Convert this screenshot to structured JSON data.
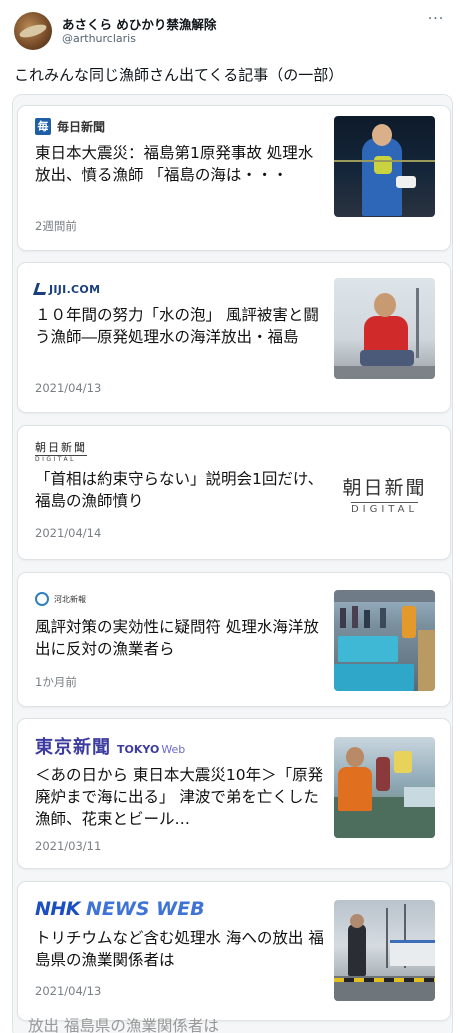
{
  "tweet": {
    "display_name": "あさくら めひかり禁漁解除",
    "handle": "@arthurclaris",
    "text": "これみんな同じ漁師さん出てくる記事（の一部）"
  },
  "cards": [
    {
      "source_name": "毎日新聞",
      "logo_mark": "毎",
      "headline": "東日本大震災：福島第1原発事故 処理水放出、憤る漁師 「福島の海は・・・",
      "date": "2週間前"
    },
    {
      "source_name": "JIJI.COM",
      "headline": "１０年間の努力「水の泡」 風評被害と闘う漁師―原発処理水の海洋放出・福島",
      "date": "2021/04/13"
    },
    {
      "source_name": "朝日新聞",
      "source_sub": "DIGITAL",
      "headline": "「首相は約束守らない」説明会1回だけ、福島の漁師憤り",
      "date": "2021/04/14",
      "thumb_title": "朝日新聞",
      "thumb_sub": "DIGITAL"
    },
    {
      "source_name": "河北新報",
      "headline": "風評対策の実効性に疑問符 処理水海洋放出に反対の漁業者ら",
      "date": "1か月前"
    },
    {
      "source_name": "東京新聞",
      "source_en": "TOKYO",
      "source_web": "Web",
      "headline": "＜あの日から 東日本大震災10年＞「原発廃炉まで海に出る」 津波で弟を亡くした漁師、花束とビール…",
      "date": "2021/03/11"
    },
    {
      "source_name": "NHK",
      "source_sub": "NEWS WEB",
      "headline": "トリチウムなど含む処理水 海への放出 福島県の漁業関係者は",
      "date": "2021/04/13"
    }
  ],
  "bottom_peek_text": "放出 福島県の漁業関係者は"
}
